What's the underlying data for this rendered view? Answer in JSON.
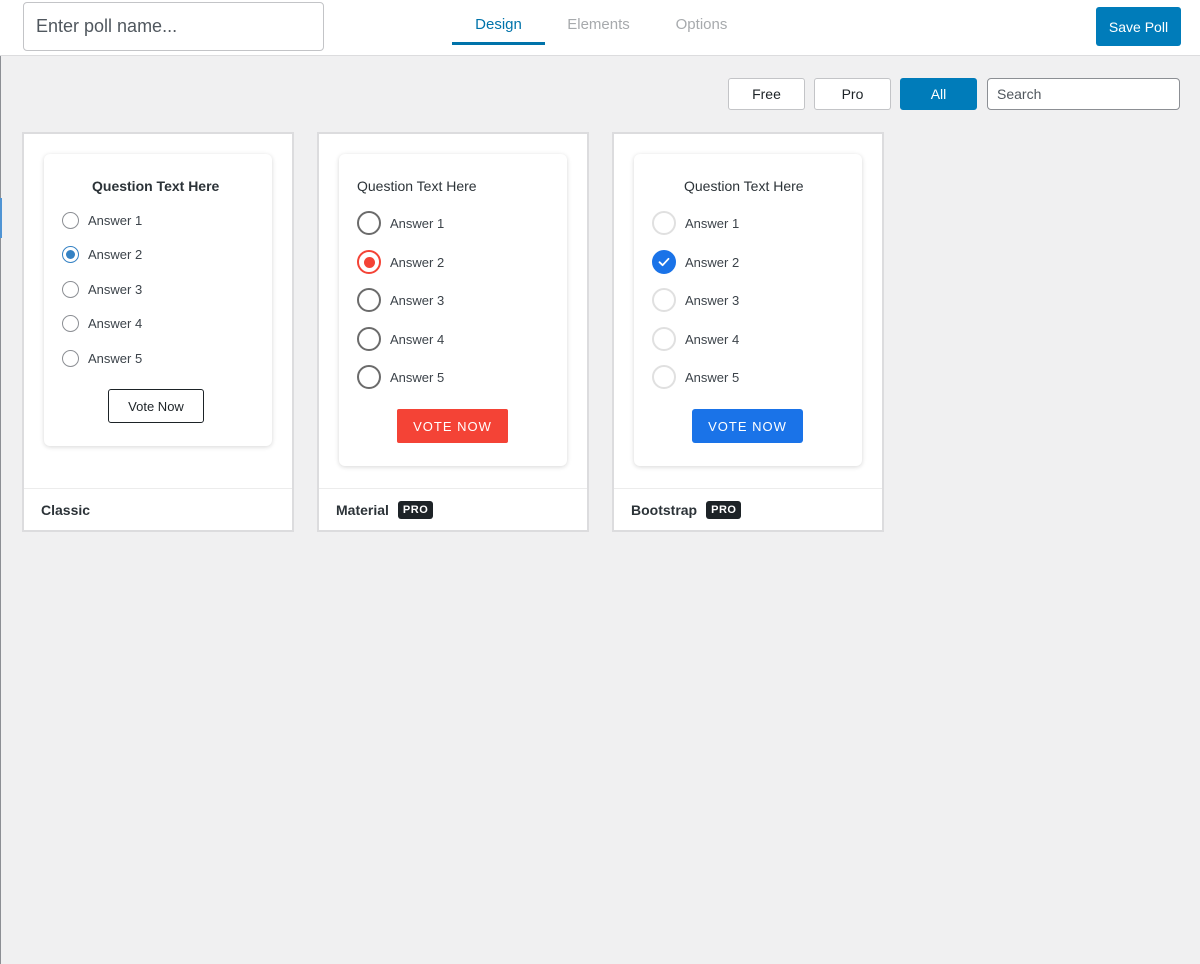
{
  "header": {
    "poll_name_value": "",
    "poll_name_placeholder": "Enter poll name...",
    "tabs": [
      {
        "label": "Design",
        "active": true
      },
      {
        "label": "Elements",
        "active": false
      },
      {
        "label": "Options",
        "active": false
      }
    ],
    "save_label": "Save Poll"
  },
  "filters": {
    "buttons": [
      {
        "label": "Free",
        "active": false
      },
      {
        "label": "Pro",
        "active": false
      },
      {
        "label": "All",
        "active": true
      }
    ],
    "search_placeholder": "Search",
    "search_value": ""
  },
  "templates": [
    {
      "name": "Classic",
      "pro_badge": "",
      "question": "Question Text Here",
      "answers": [
        "Answer 1",
        "Answer 2",
        "Answer 3",
        "Answer 4",
        "Answer 5"
      ],
      "selected_answer": "Answer 2",
      "vote_label": "Vote Now"
    },
    {
      "name": "Material",
      "pro_badge": "PRO",
      "question": "Question Text Here",
      "answers": [
        "Answer 1",
        "Answer 2",
        "Answer 3",
        "Answer 4",
        "Answer 5"
      ],
      "selected_answer": "Answer 2",
      "vote_label": "VOTE NOW"
    },
    {
      "name": "Bootstrap",
      "pro_badge": "PRO",
      "question": "Question Text Here",
      "answers": [
        "Answer 1",
        "Answer 2",
        "Answer 3",
        "Answer 4",
        "Answer 5"
      ],
      "selected_answer": "Answer 2",
      "vote_label": "VOTE NOW"
    }
  ],
  "colors": {
    "accent": "#007cba",
    "active_tab": "#0073aa",
    "material_accent": "#f44336",
    "bootstrap_accent": "#1a73e8",
    "classic_radio": "#3582c4"
  },
  "icons": {
    "bootstrap_checked": "checkmark-icon"
  }
}
